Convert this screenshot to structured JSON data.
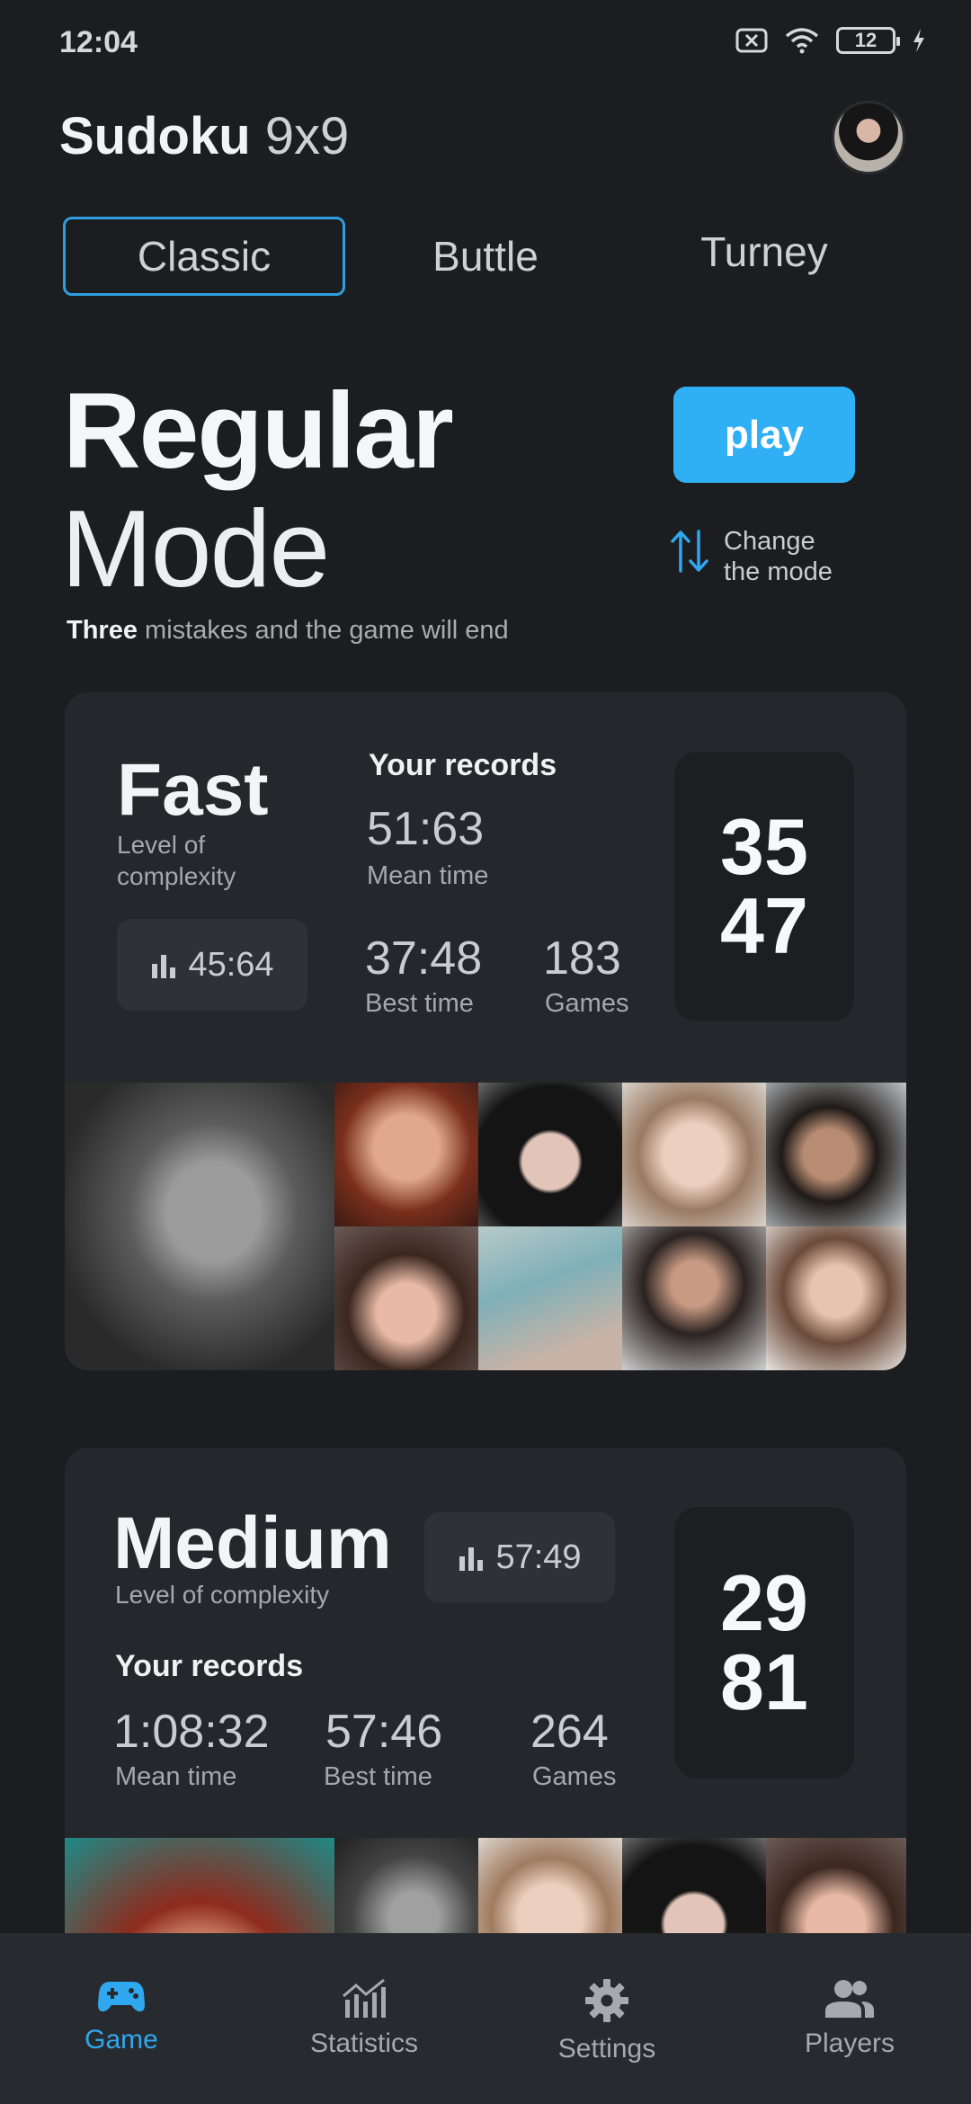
{
  "status_bar": {
    "time": "12:04",
    "battery": "12"
  },
  "header": {
    "title_bold": "Sudoku",
    "title_light": "9x9"
  },
  "tabs": [
    {
      "label": "Classic",
      "active": true
    },
    {
      "label": "Buttle",
      "active": false
    },
    {
      "label": "Turney",
      "active": false
    }
  ],
  "mode": {
    "title_bold": "Regular",
    "title_light": "Mode",
    "desc_bold": "Three",
    "desc_rest": "mistakes and the game will end",
    "play_label": "play",
    "change_line1": "Change",
    "change_line2": "the mode"
  },
  "cards": [
    {
      "level": "Fast",
      "level_sub_1": "Level of",
      "level_sub_2": "complexity",
      "stat_pill": "45:64",
      "records_title": "Your records",
      "mean_time": "51:63",
      "mean_label": "Mean time",
      "best_time": "37:48",
      "best_label": "Best time",
      "games": "183",
      "games_label": "Games",
      "score_top": "35",
      "score_bottom": "47"
    },
    {
      "level": "Medium",
      "level_sub": "Level of complexity",
      "stat_pill": "57:49",
      "records_title": "Your records",
      "mean_time": "1:08:32",
      "mean_label": "Mean time",
      "best_time": "57:46",
      "best_label": "Best time",
      "games": "264",
      "games_label": "Games",
      "score_top": "29",
      "score_bottom": "81"
    }
  ],
  "bottom_nav": [
    {
      "label": "Game",
      "icon": "gamepad-icon",
      "active": true
    },
    {
      "label": "Statistics",
      "icon": "statistics-icon",
      "active": false
    },
    {
      "label": "Settings",
      "icon": "gear-icon",
      "active": false
    },
    {
      "label": "Players",
      "icon": "players-icon",
      "active": false
    }
  ],
  "colors": {
    "accent": "#2fb0f5",
    "background": "#1b1d20",
    "card": "#24272b"
  }
}
